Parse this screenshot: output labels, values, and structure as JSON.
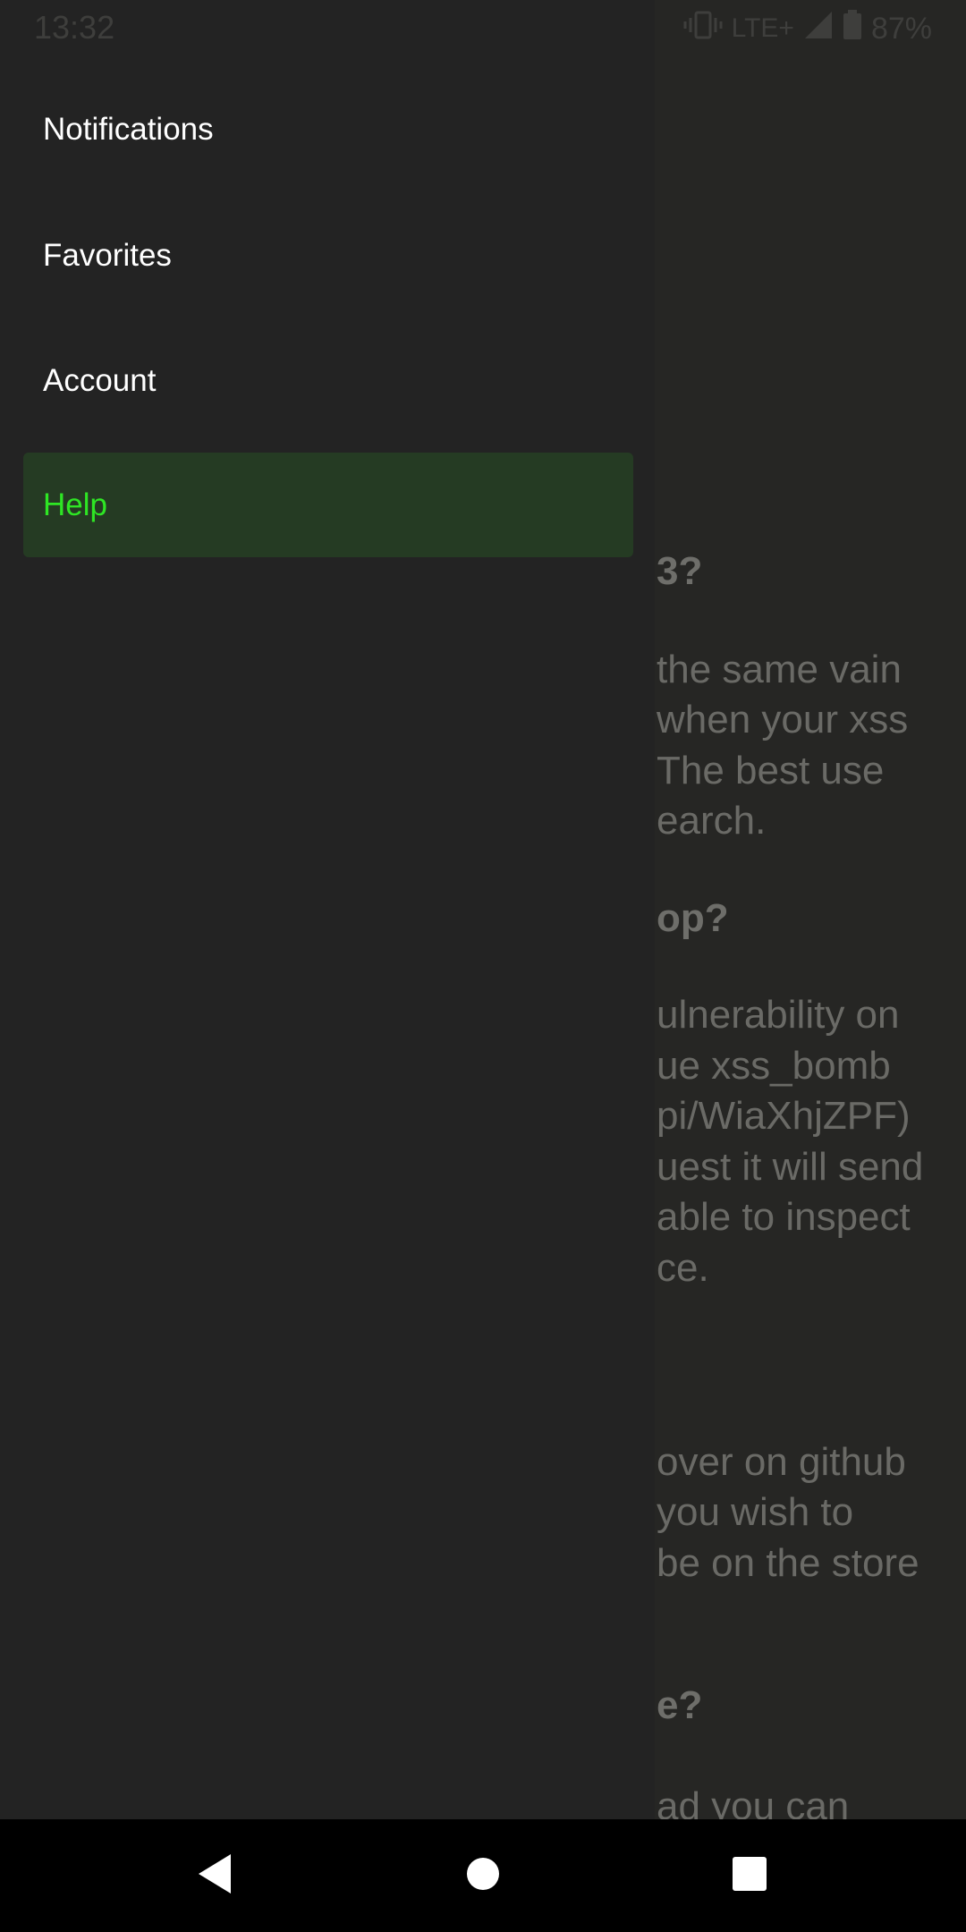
{
  "status_bar": {
    "time": "13:32",
    "network": "LTE+",
    "battery": "87%",
    "icons": [
      "vibrate-icon",
      "signal-icon",
      "battery-icon"
    ]
  },
  "drawer": {
    "items": [
      {
        "label": "Notifications",
        "active": false
      },
      {
        "label": "Favorites",
        "active": false
      },
      {
        "label": "Account",
        "active": false
      },
      {
        "label": "Help",
        "active": true
      }
    ]
  },
  "background_page": {
    "headings": [
      "3?",
      "op?",
      "e?"
    ],
    "paragraphs": [
      [
        "the same vain",
        "when your xss",
        "The best use",
        "earch."
      ],
      [
        "ulnerability on",
        "ue xss_bomb",
        "pi/WiaXhjZPF)",
        "uest it will send",
        "able to inspect",
        "ce."
      ],
      [
        "over on github",
        "you wish to",
        "be on the store"
      ],
      [
        "ad you can"
      ]
    ]
  },
  "navigation_bar": {
    "buttons": [
      "back-icon",
      "home-icon",
      "recents-icon"
    ]
  },
  "colors": {
    "drawer_background": "#232323",
    "active_item_background": "#253b23",
    "active_item_text": "#2ee624",
    "item_text": "#ffffff",
    "nav_bar": "#000000"
  }
}
